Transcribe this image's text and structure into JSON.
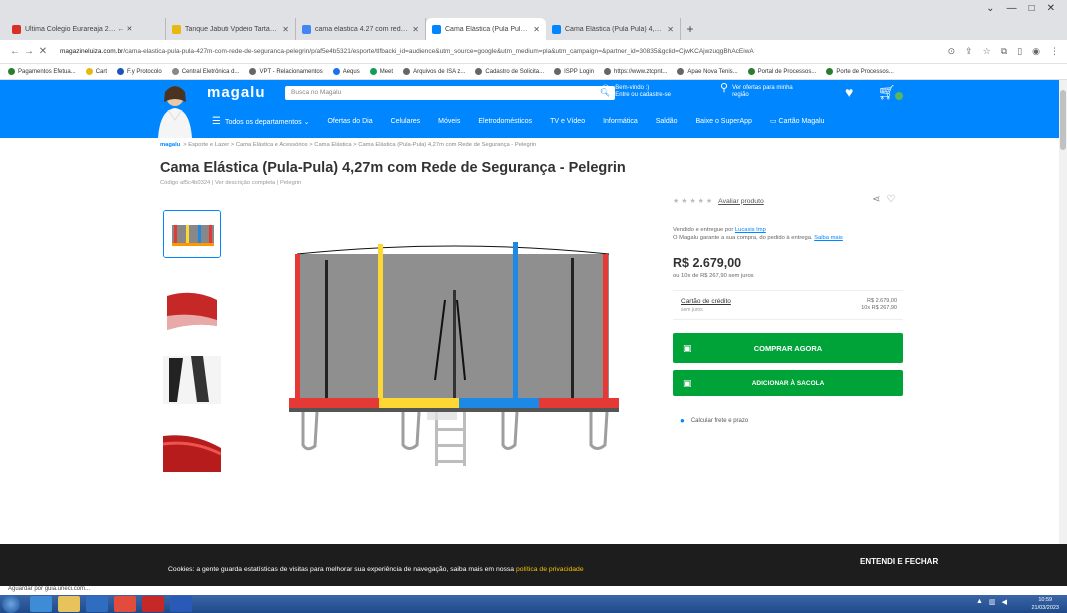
{
  "browser": {
    "tabs": [
      {
        "label": "Ultima Colegio Eurareaja 2… ← ✕",
        "color": "#d93025",
        "active": false
      },
      {
        "label": "Tanque Jabuti Vpdeio Tartarugo",
        "color": "#e8b810",
        "active": false
      },
      {
        "label": "cama elastica 4.27 com rede seg",
        "color": "#4285f4",
        "active": false
      },
      {
        "label": "Cama Elástica (Pula Pula) 4,27m",
        "color": "#0086ff",
        "active": true
      },
      {
        "label": "Cama Elástica (Pula Pula) 4,27…",
        "color": "#0086ff",
        "active": false
      }
    ],
    "new_tab": "+",
    "window_controls": [
      "⌄",
      "—",
      "□",
      "✕"
    ],
    "url_domain": "magazineluiza.com.br",
    "url_path": "/cama-elastica-pula-pula-427m-com-rede-de-seguranca-pelegrin/p/af5e4b5321/esporte/tlfbacki_id=audience&utm_source=google&utm_medium=pla&utm_campaign=&partner_id=30835&gclid=CjwKCAjwzuqgBhAcEiwA",
    "bookmarks": [
      "Pagamentos Efetua...",
      "Cart",
      "F.y Protocolo",
      "Central Eletrônica d...",
      "VPT - Relacionamentos",
      "Aequs",
      "Meet",
      "Arquivos de ISA z...",
      "Cadastro de Solicita...",
      "ISPP Login",
      "https://www.ztcpnt...",
      "Apae Nova Tenis...",
      "Portal de Processos...",
      "Porte de Processos..."
    ]
  },
  "header": {
    "logo": "magalu",
    "search_placeholder": "Busca no Magalu",
    "login_line1": "Bem-vindo :)",
    "login_line2": "Entre ou cadastre-se",
    "location_line1": "Ver ofertas para minha",
    "location_line2": "região",
    "nav": [
      "Todos os departamentos",
      "Ofertas do Dia",
      "Celulares",
      "Móveis",
      "Eletrodomésticos",
      "TV e Vídeo",
      "Informática",
      "Saldão",
      "Baixe o SuperApp",
      "Cartão Magalu"
    ]
  },
  "product": {
    "breadcrumb_brand": "magalu",
    "breadcrumb": "> Esporte e Lazer > Cama Elástica e Acessórios > Cama Elástica > Cama Elástica (Pula-Pula) 4,27m com Rede de Segurança - Pelegrin",
    "title": "Cama Elástica (Pula-Pula) 4,27m com Rede de Segurança - Pelegrin",
    "code": "Código af5c4b0324 | Ver descrição completa | Pelegrin",
    "stars": "★ ★ ★ ★ ★",
    "rating_link": "Avaliar produto",
    "seller_prefix": "Vendido e entregue por ",
    "seller_name": "Lucaxis Imp",
    "guarantee": "O Magalu garante a sua compra, do pedido à entrega. ",
    "guarantee_link": "Saiba mais",
    "price": "R$ 2.679,00",
    "installments": "ou 10x de R$ 267,90 sem juros",
    "card_label": "Cartão de crédito",
    "card_sub": "sem juros",
    "card_val1": "R$ 2.679,00",
    "card_val2": "10x R$ 267,90",
    "buy_label": "COMPRAR AGORA",
    "bag_label": "ADICIONAR À SACOLA",
    "freight_label": "Calcular frete e prazo"
  },
  "cookie": {
    "text": "Cookies: a gente guarda estatísticas de visitas para melhorar sua experiência de navegação, saiba mais em nossa ",
    "policy": "política de privacidade",
    "button": "ENTENDI E FECHAR"
  },
  "status_text": "Aguardar por guia.uneci.com...",
  "clock": {
    "time": "10:59",
    "date": "21/03/2023"
  },
  "colors": {
    "brand_blue": "#0086ff",
    "buy_green": "#00a337",
    "cookie_bg": "#1d1d1d"
  }
}
